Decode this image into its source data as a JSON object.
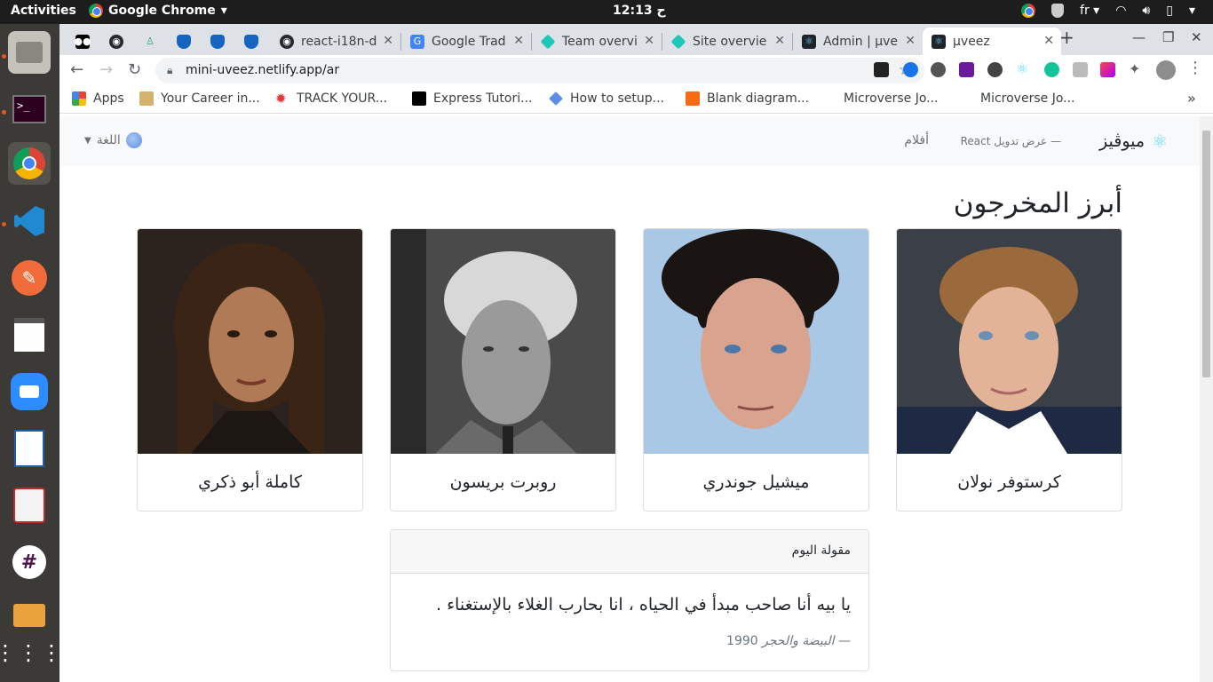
{
  "topbar": {
    "activities": "Activities",
    "app_name": "Google Chrome",
    "clock": "ح 12:13",
    "lang_indicator": "fr"
  },
  "dock": {
    "items": [
      "files-icon",
      "terminal-icon",
      "chrome-icon",
      "vscode-icon",
      "postman-icon",
      "text-editor-icon",
      "zoom-icon",
      "libreoffice-writer-icon",
      "document-viewer-icon",
      "slack-icon",
      "folder-icon",
      "show-apps-icon"
    ]
  },
  "tabs": [
    {
      "title": "",
      "icon": "medium-icon"
    },
    {
      "title": "",
      "icon": "github-icon"
    },
    {
      "title": "",
      "icon": "extension-icon"
    },
    {
      "title": "",
      "icon": "shield-icon"
    },
    {
      "title": "",
      "icon": "shield-icon"
    },
    {
      "title": "",
      "icon": "shield-icon"
    },
    {
      "title": "react-i18n-d",
      "icon": "github-icon"
    },
    {
      "title": "Google Trad",
      "icon": "translate-icon"
    },
    {
      "title": "Team overvi",
      "icon": "netlify-icon"
    },
    {
      "title": "Site overvie",
      "icon": "netlify-icon"
    },
    {
      "title": "Admin | μve",
      "icon": "react-icon"
    },
    {
      "title": "μveez",
      "icon": "react-icon"
    }
  ],
  "toolbar": {
    "url": "mini-uveez.netlify.app/ar"
  },
  "bookmarks": [
    {
      "label": "Apps",
      "icon": "apps-grid-icon"
    },
    {
      "label": "Your Career in...",
      "icon": "trophy-icon"
    },
    {
      "label": "TRACK YOUR...",
      "icon": "maple-leaf-icon"
    },
    {
      "label": "Express Tutori...",
      "icon": "express-icon"
    },
    {
      "label": "How to setup...",
      "icon": "diamond-icon"
    },
    {
      "label": "Blank diagram...",
      "icon": "lucidchart-icon"
    },
    {
      "label": "Microverse Jo...",
      "icon": ""
    },
    {
      "label": "Microverse Jo...",
      "icon": ""
    }
  ],
  "page": {
    "brand": "ميوڤيز",
    "tagline": "— عرض تدويل React",
    "nav_movies": "أفلام",
    "language_menu": "اللغة",
    "heading": "أبرز المخرجون",
    "directors": [
      {
        "name": "كرستوفر نولان"
      },
      {
        "name": "ميشيل جوندري"
      },
      {
        "name": "روبرت بريسون"
      },
      {
        "name": "كاملة أبو ذكري"
      }
    ],
    "quote": {
      "header": "مقولة اليوم",
      "text": "يا بيه أنا صاحب مبدأ في الحياه ، انا بحارب الغلاء بالإستغناء .",
      "source": "— البيضة والحجر",
      "year": "1990"
    }
  },
  "colors": {
    "navbar_bg": "#f8f9fa",
    "react_blue": "#61dafb",
    "tab_strip": "#dee1e6",
    "dock_bg": "#3b3a36"
  }
}
